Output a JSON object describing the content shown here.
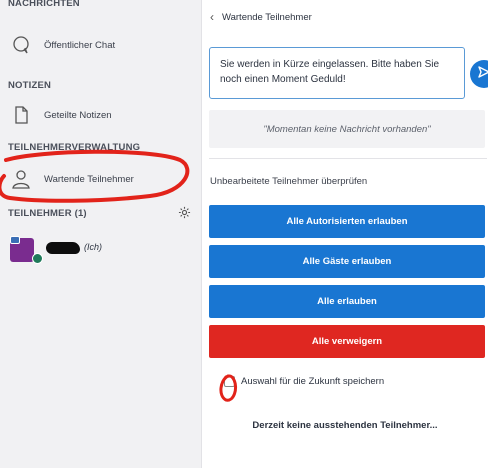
{
  "sidebar": {
    "sections": {
      "messages": "NACHRICHTEN",
      "notes": "NOTIZEN",
      "management": "TEILNEHMERVERWALTUNG",
      "participants": "TEILNEHMER (1)"
    },
    "items": {
      "public_chat": "Öffentlicher Chat",
      "shared_notes": "Geteilte Notizen",
      "waiting_users": "Wartende Teilnehmer"
    },
    "user": {
      "suffix": "(Ich)"
    }
  },
  "main": {
    "back_label": "Wartende Teilnehmer",
    "message_input_value": "Sie werden in Kürze eingelassen. Bitte haben Sie noch einen Moment Geduld!",
    "no_message": "\"Momentan keine Nachricht vorhanden\"",
    "review_label": "Unbearbeitete Teilnehmer überprüfen",
    "buttons": {
      "allow_authenticated": "Alle Autorisierten erlauben",
      "allow_guests": "Alle Gäste erlauben",
      "allow_all": "Alle erlauben",
      "deny_all": "Alle verweigern"
    },
    "remember_choice": "Auswahl für die Zukunft speichern",
    "no_pending": "Derzeit keine ausstehenden Teilnehmer..."
  },
  "colors": {
    "primary": "#1976d2",
    "danger": "#df2721",
    "annotation": "#e2231a"
  }
}
